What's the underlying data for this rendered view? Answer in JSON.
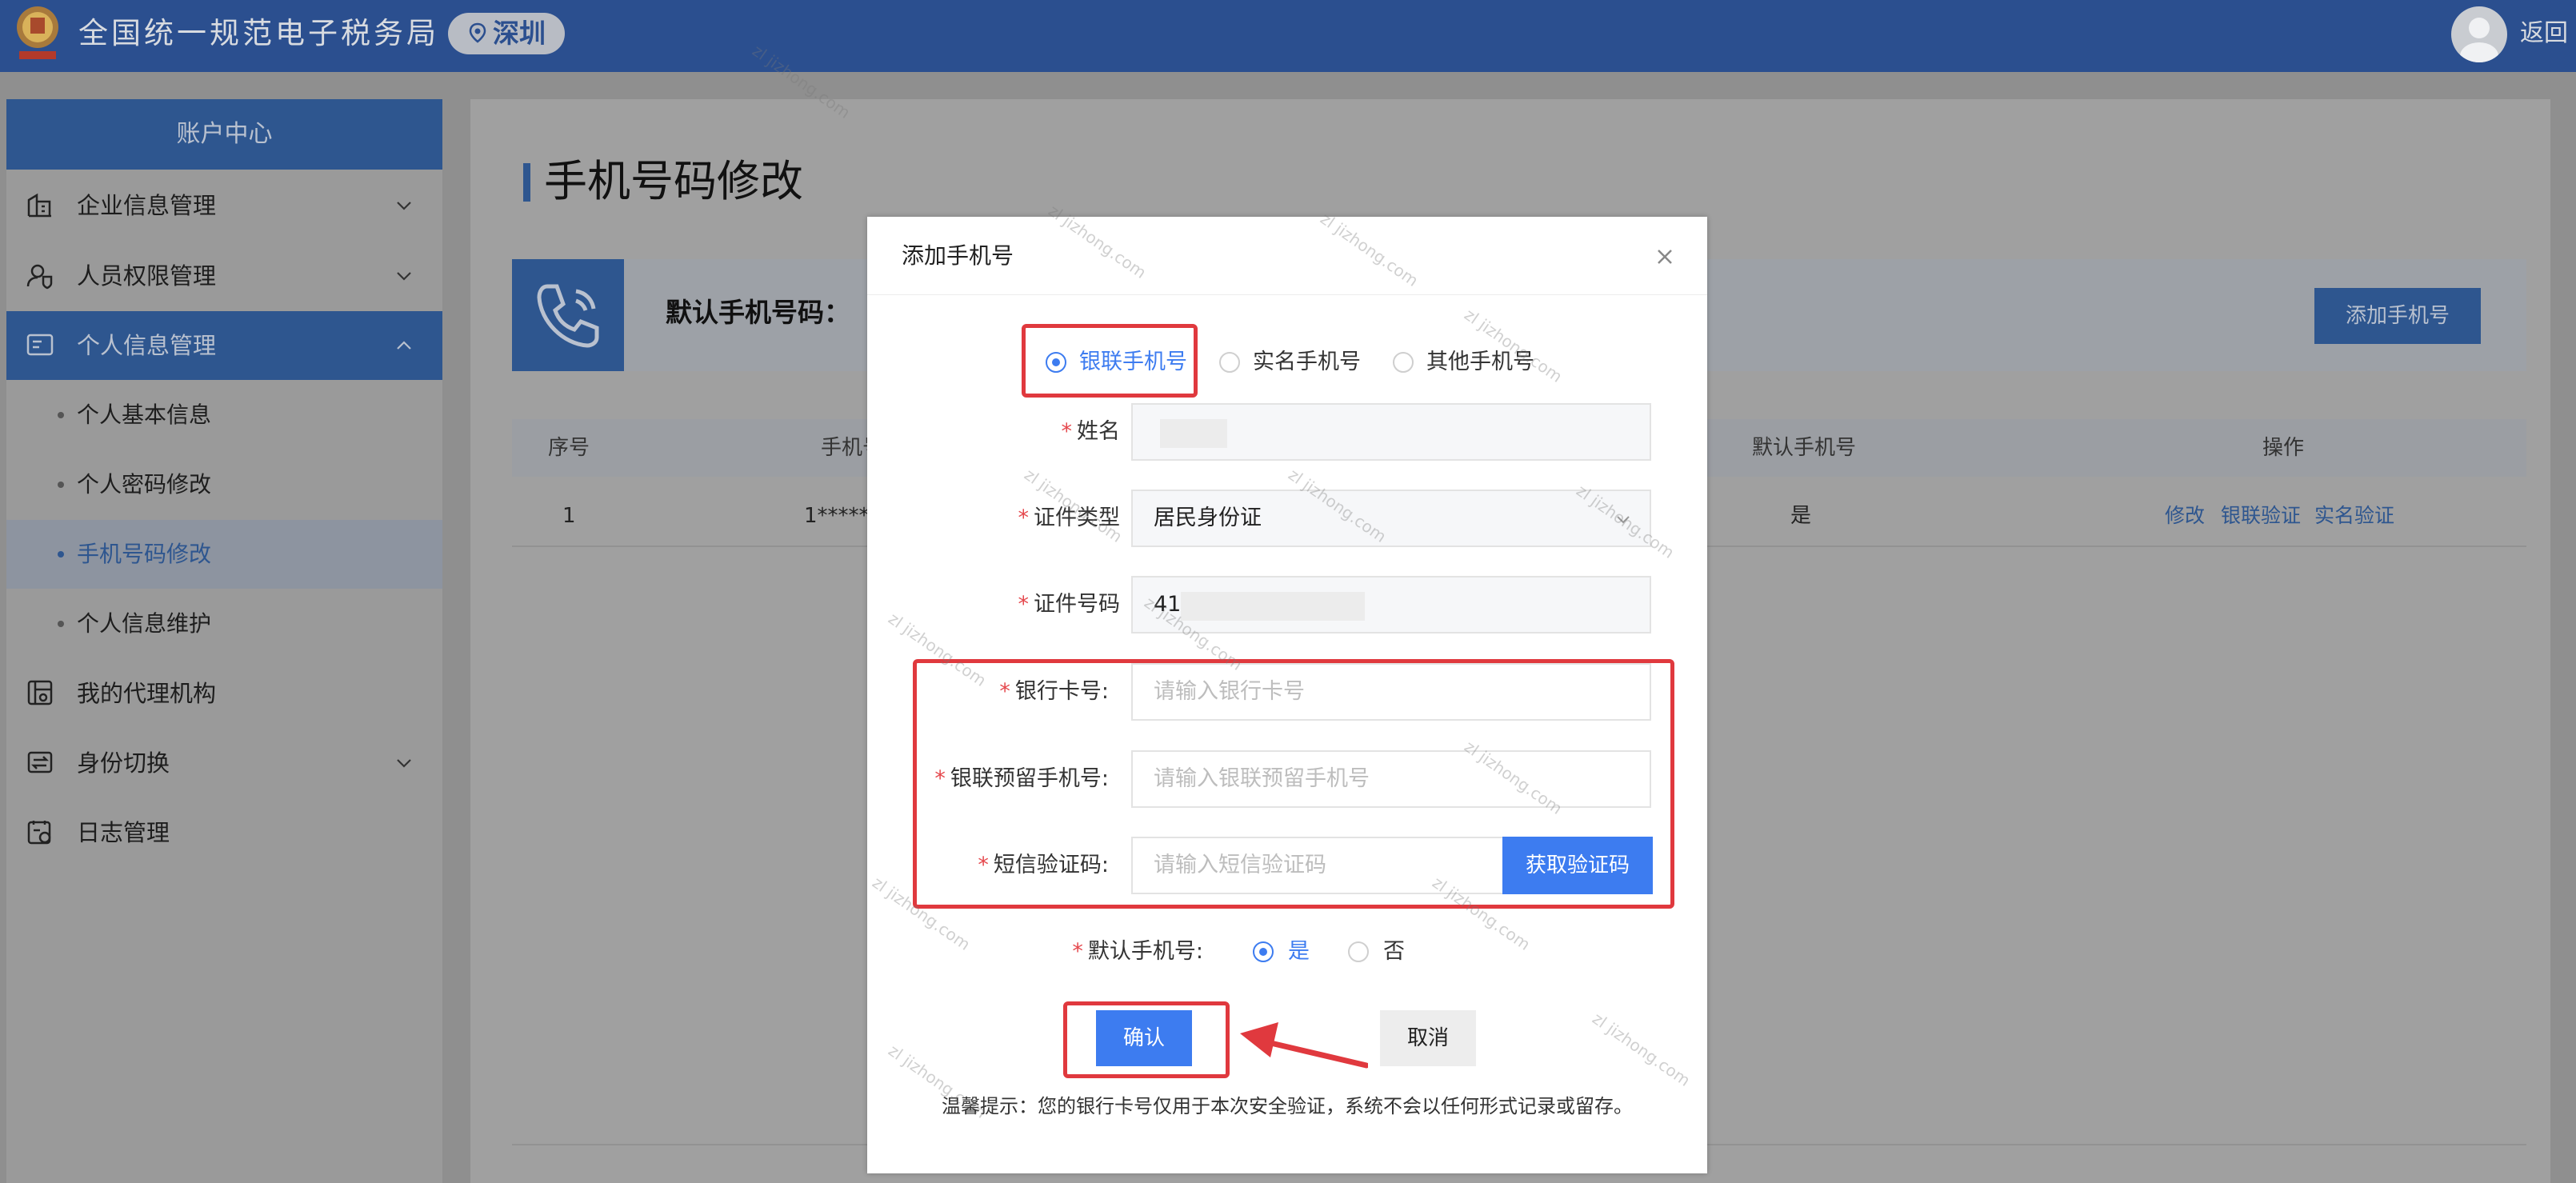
{
  "header": {
    "title": "全国统一规范电子税务局",
    "region": "深圳",
    "back": "返回"
  },
  "sidebar": {
    "title": "账户中心",
    "items": [
      {
        "label": "企业信息管理",
        "icon": "building-icon"
      },
      {
        "label": "人员权限管理",
        "icon": "user-shield-icon"
      },
      {
        "label": "个人信息管理",
        "icon": "id-card-icon"
      },
      {
        "label": "我的代理机构",
        "icon": "agency-icon"
      },
      {
        "label": "身份切换",
        "icon": "switch-icon"
      },
      {
        "label": "日志管理",
        "icon": "log-icon"
      }
    ],
    "sub_items": [
      "个人基本信息",
      "个人密码修改",
      "手机号码修改",
      "个人信息维护"
    ]
  },
  "main": {
    "title": "手机号码修改",
    "default_phone_label": "默认手机号码：",
    "add_button": "添加手机号",
    "table": {
      "headers": [
        "序号",
        "手机号",
        "默认手机号",
        "操作"
      ],
      "rows": [
        {
          "index": "1",
          "phone": "1******",
          "default": "是"
        }
      ],
      "actions": [
        "修改",
        "银联验证",
        "实名验证"
      ]
    }
  },
  "modal": {
    "title": "添加手机号",
    "radio_options": [
      "银联手机号",
      "实名手机号",
      "其他手机号"
    ],
    "selected_option": "银联手机号",
    "fields": {
      "name_label": "姓名",
      "id_type_label": "证件类型",
      "id_type_value": "居民身份证",
      "id_number_label": "证件号码",
      "id_number_value": "41",
      "bank_card_label": "银行卡号:",
      "bank_card_placeholder": "请输入银行卡号",
      "reserved_phone_label": "银联预留手机号:",
      "reserved_phone_placeholder": "请输入银联预留手机号",
      "sms_label": "短信验证码:",
      "sms_placeholder": "请输入短信验证码",
      "sms_button": "获取验证码",
      "default_label": "默认手机号:",
      "default_yes": "是",
      "default_no": "否"
    },
    "confirm": "确认",
    "cancel": "取消",
    "tip": "温馨提示：您的银行卡号仅用于本次安全验证，系统不会以任何形式记录或留存。"
  },
  "watermark": "zl jizhong.com",
  "colors": {
    "header": "#2b4f8f",
    "primary": "#3d7cf0",
    "highlight": "#e0393e",
    "required": "#e5484d"
  }
}
